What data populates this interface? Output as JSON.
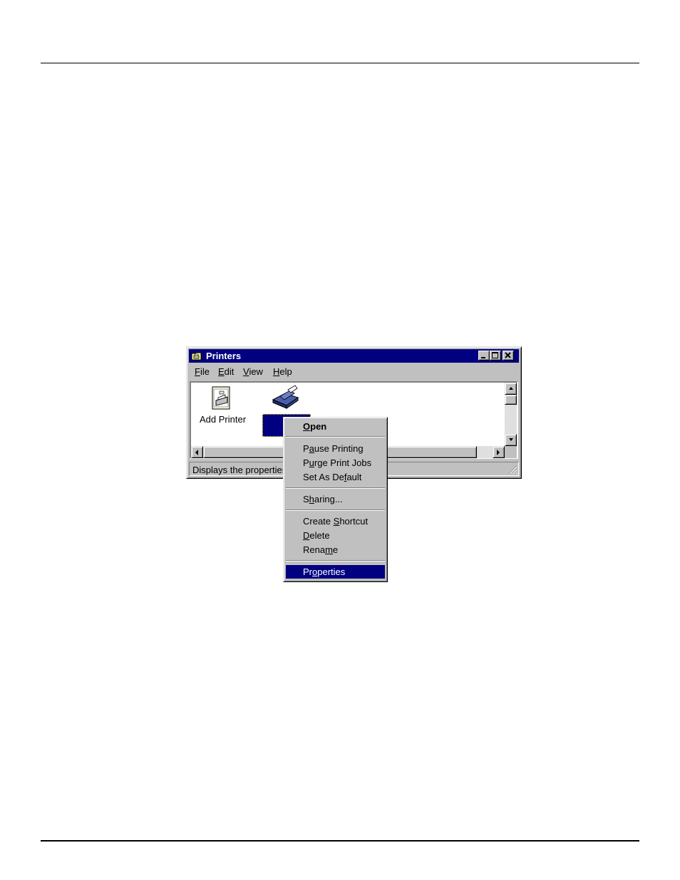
{
  "window": {
    "title": "Printers",
    "menu": [
      {
        "pre": "",
        "u": "F",
        "post": "ile"
      },
      {
        "pre": "",
        "u": "E",
        "post": "dit"
      },
      {
        "pre": "",
        "u": "V",
        "post": "iew"
      },
      {
        "pre": "",
        "u": "H",
        "post": "elp"
      }
    ],
    "icons": {
      "add_printer_label": "Add Printer"
    },
    "status_text": "Displays the properties"
  },
  "context_menu": {
    "items": [
      {
        "pre": "",
        "u": "O",
        "post": "pen",
        "bold": true
      },
      {
        "pre": "P",
        "u": "a",
        "post": "use Printing"
      },
      {
        "pre": "P",
        "u": "u",
        "post": "rge Print Jobs"
      },
      {
        "pre": "Set As De",
        "u": "f",
        "post": "ault"
      },
      {
        "pre": "S",
        "u": "h",
        "post": "aring..."
      },
      {
        "pre": "Create ",
        "u": "S",
        "post": "hortcut"
      },
      {
        "pre": "",
        "u": "D",
        "post": "elete"
      },
      {
        "pre": "Rena",
        "u": "m",
        "post": "e"
      },
      {
        "pre": "Pr",
        "u": "o",
        "post": "perties",
        "highlighted": true
      }
    ]
  },
  "colors": {
    "title_bar": "#000080",
    "face": "#c0c0c0",
    "highlight": "#000080"
  }
}
